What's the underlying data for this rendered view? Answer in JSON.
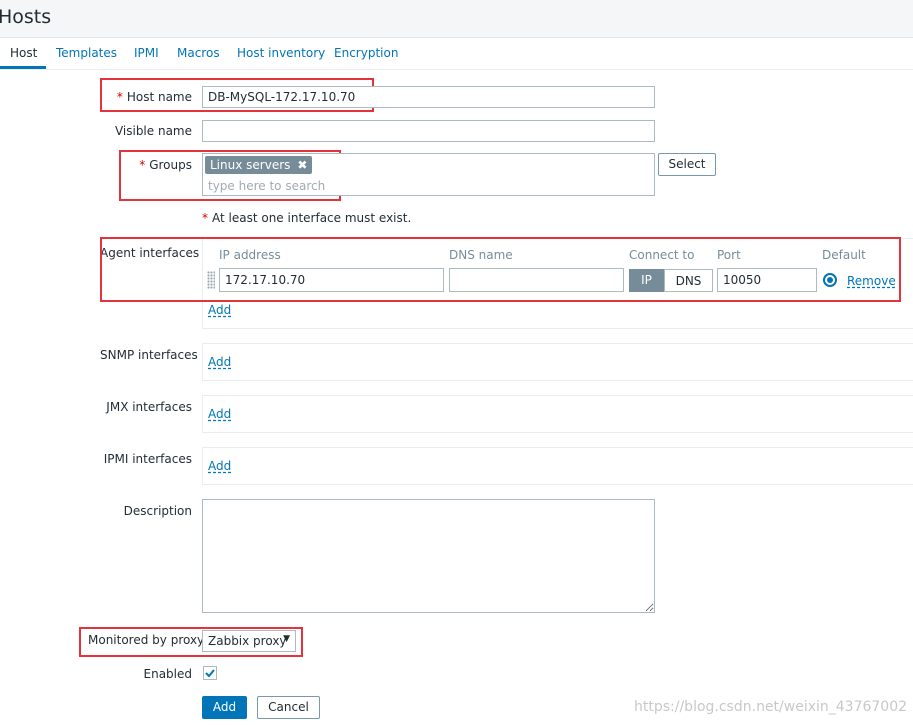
{
  "header": {
    "title": "Hosts"
  },
  "tabs": [
    {
      "label": "Host"
    },
    {
      "label": "Templates"
    },
    {
      "label": "IPMI"
    },
    {
      "label": "Macros"
    },
    {
      "label": "Host inventory"
    },
    {
      "label": "Encryption"
    }
  ],
  "form": {
    "host_name": {
      "label": "Host name",
      "required": "*",
      "value": "DB-MySQL-172.17.10.70"
    },
    "visible_name": {
      "label": "Visible name",
      "value": ""
    },
    "groups": {
      "label": "Groups",
      "required": "*",
      "tag": "Linux servers",
      "placeholder": "type here to search",
      "select_label": "Select"
    },
    "interface_warning": {
      "mark": "*",
      "text": "At least one interface must exist."
    },
    "agent_interfaces": {
      "label": "Agent interfaces",
      "columns": [
        "IP address",
        "DNS name",
        "Connect to",
        "Port",
        "Default"
      ],
      "row": {
        "ip": "172.17.10.70",
        "dns": "",
        "connect_ip": "IP",
        "connect_dns": "DNS",
        "port": "10050",
        "remove": "Remove"
      },
      "add": "Add"
    },
    "snmp_interfaces": {
      "label": "SNMP interfaces",
      "add": "Add"
    },
    "jmx_interfaces": {
      "label": "JMX interfaces",
      "add": "Add"
    },
    "ipmi_interfaces": {
      "label": "IPMI interfaces",
      "add": "Add"
    },
    "description": {
      "label": "Description",
      "value": ""
    },
    "monitored_by_proxy": {
      "label": "Monitored by proxy",
      "value": "Zabbix proxy"
    },
    "enabled": {
      "label": "Enabled",
      "checked": true
    },
    "buttons": {
      "add": "Add",
      "cancel": "Cancel"
    }
  },
  "watermark": "https://blog.csdn.net/weixin_43767002",
  "colors": {
    "accent": "#0275b8",
    "highlight": "#e3333c",
    "required": "#d40000",
    "tag": "#768d99"
  }
}
